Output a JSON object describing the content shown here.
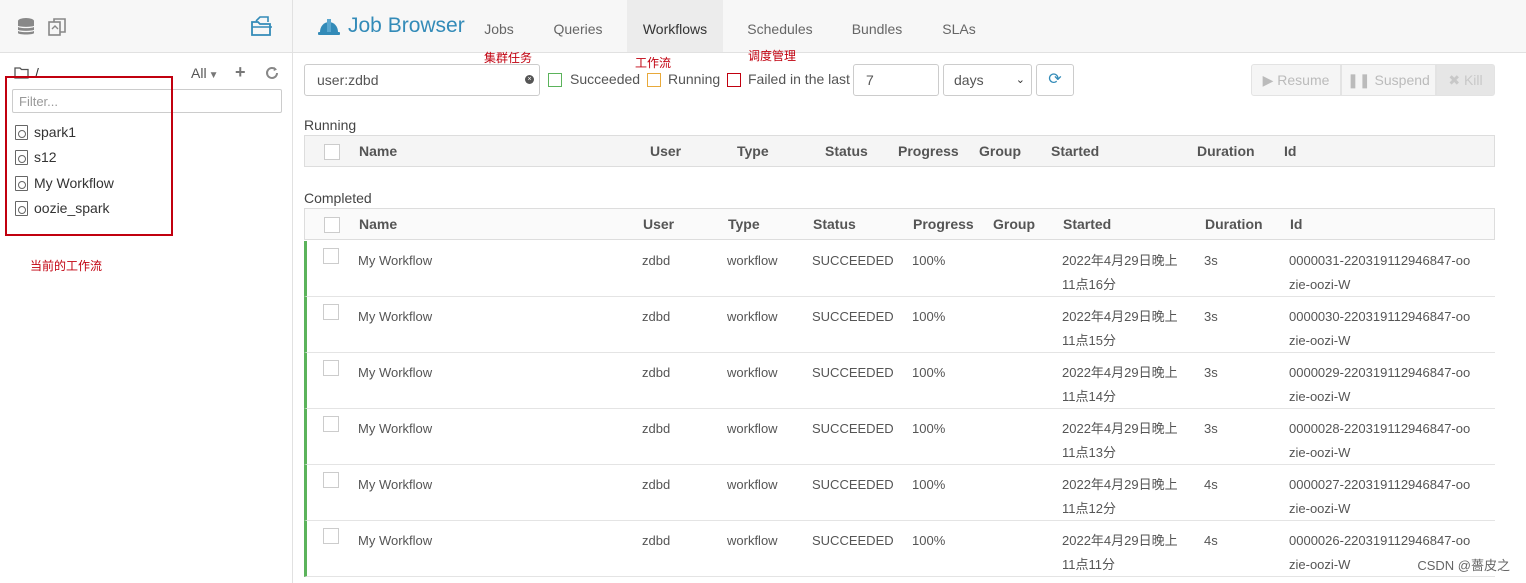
{
  "sidebar": {
    "path": "/",
    "scope": "All",
    "filter_placeholder": "Filter...",
    "items": [
      {
        "label": "spark1"
      },
      {
        "label": "s12"
      },
      {
        "label": "My Workflow"
      },
      {
        "label": "oozie_spark"
      }
    ],
    "annotation": "当前的工作流"
  },
  "nav": {
    "brand": "Job Browser",
    "tabs": [
      {
        "label": "Jobs"
      },
      {
        "label": "Queries"
      },
      {
        "label": "Workflows"
      },
      {
        "label": "Schedules"
      },
      {
        "label": "Bundles"
      },
      {
        "label": "SLAs"
      }
    ],
    "annotations": {
      "jobs": "集群任务",
      "workflows": "工作流",
      "schedules": "调度管理"
    }
  },
  "toolbar": {
    "search_value": "user:zdbd",
    "succeeded_label": "Succeeded",
    "running_label": "Running",
    "failed_label": "Failed in the last",
    "days_value": "7",
    "unit_value": "days",
    "resume_label": "Resume",
    "suspend_label": "Suspend",
    "kill_label": "Kill",
    "colors": {
      "succeeded": "#5bb35b",
      "running": "#e8a93a",
      "failed": "#c1000f"
    }
  },
  "running": {
    "title": "Running",
    "columns": [
      "Name",
      "User",
      "Type",
      "Status",
      "Progress",
      "Group",
      "Started",
      "Duration",
      "Id"
    ]
  },
  "completed": {
    "title": "Completed",
    "columns": [
      "Name",
      "User",
      "Type",
      "Status",
      "Progress",
      "Group",
      "Started",
      "Duration",
      "Id"
    ],
    "rows": [
      {
        "name": "My Workflow",
        "user": "zdbd",
        "type": "workflow",
        "status": "SUCCEEDED",
        "progress": "100%",
        "group": "",
        "started": "2022年4月29日晚上11点16分",
        "duration": "3s",
        "id": "0000031-220319112946847-oozie-oozi-W"
      },
      {
        "name": "My Workflow",
        "user": "zdbd",
        "type": "workflow",
        "status": "SUCCEEDED",
        "progress": "100%",
        "group": "",
        "started": "2022年4月29日晚上11点15分",
        "duration": "3s",
        "id": "0000030-220319112946847-oozie-oozi-W"
      },
      {
        "name": "My Workflow",
        "user": "zdbd",
        "type": "workflow",
        "status": "SUCCEEDED",
        "progress": "100%",
        "group": "",
        "started": "2022年4月29日晚上11点14分",
        "duration": "3s",
        "id": "0000029-220319112946847-oozie-oozi-W"
      },
      {
        "name": "My Workflow",
        "user": "zdbd",
        "type": "workflow",
        "status": "SUCCEEDED",
        "progress": "100%",
        "group": "",
        "started": "2022年4月29日晚上11点13分",
        "duration": "3s",
        "id": "0000028-220319112946847-oozie-oozi-W"
      },
      {
        "name": "My Workflow",
        "user": "zdbd",
        "type": "workflow",
        "status": "SUCCEEDED",
        "progress": "100%",
        "group": "",
        "started": "2022年4月29日晚上11点12分",
        "duration": "4s",
        "id": "0000027-220319112946847-oozie-oozi-W"
      },
      {
        "name": "My Workflow",
        "user": "zdbd",
        "type": "workflow",
        "status": "SUCCEEDED",
        "progress": "100%",
        "group": "",
        "started": "2022年4月29日晚上11点11分",
        "duration": "4s",
        "id": "0000026-220319112946847-oozie-oozi-W"
      }
    ]
  },
  "watermark": "CSDN @薔皮之"
}
